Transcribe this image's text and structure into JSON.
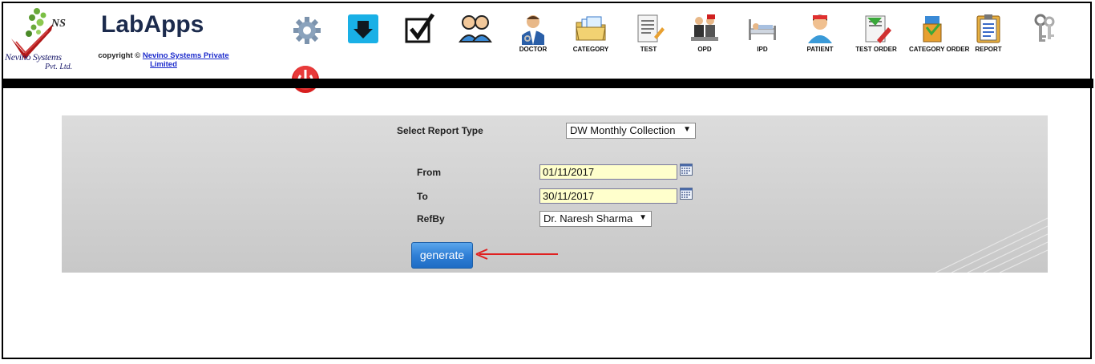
{
  "header": {
    "app_title": "LabApps",
    "copyright_prefix": "copyright ©",
    "copyright_link": "Nevino Systems Private Limited",
    "logo": {
      "ns": "NS",
      "nevino": "Nevino Systems",
      "pvt": "Pvt. Ltd."
    }
  },
  "toolbar": {
    "items": [
      {
        "label": "",
        "icon": "gear-icon"
      },
      {
        "label": "",
        "icon": "download-icon"
      },
      {
        "label": "",
        "icon": "checkbox-icon"
      },
      {
        "label": "",
        "icon": "users-icon"
      },
      {
        "label": "DOCTOR",
        "icon": "doctor-icon"
      },
      {
        "label": "CATEGORY",
        "icon": "category-folder-icon"
      },
      {
        "label": "TEST",
        "icon": "test-document-icon"
      },
      {
        "label": "OPD",
        "icon": "opd-icon"
      },
      {
        "label": "IPD",
        "icon": "hospital-bed-icon"
      },
      {
        "label": "PATIENT",
        "icon": "patient-icon"
      },
      {
        "label": "TEST ORDER",
        "icon": "test-order-icon"
      },
      {
        "label": "CATEGORY ORDER",
        "icon": "category-order-icon"
      },
      {
        "label": "REPORT",
        "icon": "report-icon"
      },
      {
        "label": "",
        "icon": "keys-icon"
      }
    ],
    "power_icon": "power-icon"
  },
  "form": {
    "report_type_label": "Select Report Type",
    "report_type_value": "DW Monthly Collection",
    "from_label": "From",
    "from_value": "01/11/2017",
    "to_label": "To",
    "to_value": "30/11/2017",
    "refby_label": "RefBy",
    "refby_value": "Dr. Naresh Sharma",
    "generate_label": "generate"
  },
  "colors": {
    "accent_blue": "#2f7fd6",
    "input_bg": "#ffffcc",
    "annotation_red": "#e02020",
    "title": "#1c2b4d"
  }
}
